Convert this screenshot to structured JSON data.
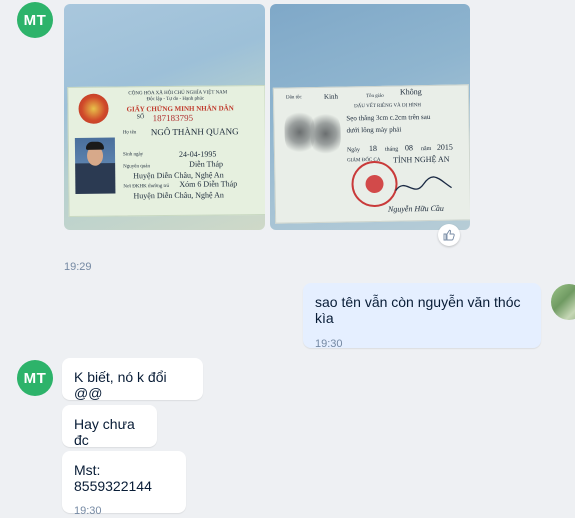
{
  "contact": {
    "initials": "MT"
  },
  "photos": {
    "front": {
      "header1": "CỘNG HÒA XÃ HỘI CHỦ NGHĨA VIỆT NAM",
      "header2": "Độc lập - Tự do - Hạnh phúc",
      "title": "GIẤY CHỨNG MINH NHÂN DÂN",
      "so_label": "SỐ",
      "number": "187183795",
      "name_label": "Họ tên",
      "name": "NGÔ THÀNH QUANG",
      "dob_label": "Sinh ngày",
      "dob": "24-04-1995",
      "origin_label": "Nguyên quán",
      "origin1": "Diễn Tháp",
      "origin2": "Huyện Diễn Châu, Nghệ An",
      "residence_label": "Nơi ĐKHK thường trú",
      "residence1": "Xóm 6 Diễn Tháp",
      "residence2": "Huyện Diễn Châu, Nghệ An"
    },
    "back": {
      "ethnic_label": "Dân tộc",
      "ethnic": "Kinh",
      "religion_label": "Tôn giáo",
      "religion": "Không",
      "marks_label": "DẤU VẾT RIÊNG VÀ DỊ HÌNH",
      "marks1": "Sẹo thẳng 3cm c.2cm trên sau",
      "marks2": "dưới lông mày phải",
      "date_prefix": "Ngày",
      "day": "18",
      "month_label": "tháng",
      "month": "08",
      "year_label": "năm",
      "year": "2015",
      "director_label": "GIÁM ĐỐC CA",
      "province": "TỈNH NGHỆ AN",
      "signer": "Nguyễn Hữu Cầu"
    }
  },
  "messages": {
    "photos_time": "19:29",
    "outgoing": {
      "text": "sao tên vẫn còn nguyễn văn thóc kìa",
      "time": "19:30"
    },
    "incoming": [
      {
        "text": "K biết, nó k đổi @@"
      },
      {
        "text": "Hay chưa đc"
      },
      {
        "text": "Mst: 8559322144",
        "time": "19:30"
      }
    ]
  },
  "colors": {
    "avatar": "#2db36a",
    "background": "#eef0f3",
    "mine_bubble": "#e5efff",
    "time": "#7589a3"
  },
  "icons": {
    "reaction": "thumbs-up-icon"
  }
}
